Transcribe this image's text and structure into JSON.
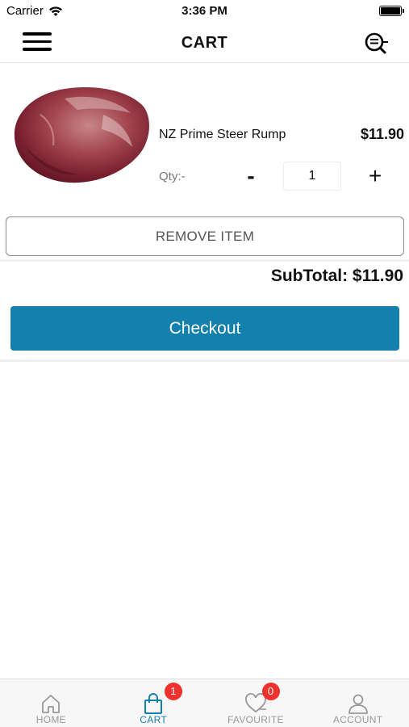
{
  "status_bar": {
    "carrier": "Carrier",
    "time": "3:36 PM"
  },
  "header": {
    "title": "CART",
    "menu_icon": "hamburger-menu-icon",
    "search_icon": "search-list-icon"
  },
  "cart": {
    "items": [
      {
        "name": "NZ Prime Steer Rump",
        "price": "$11.90",
        "qty_label": "Qty:-",
        "qty": "1",
        "minus_label": "-",
        "plus_label": "+",
        "remove_label": "REMOVE ITEM",
        "image": "raw-beef-rump-image"
      }
    ],
    "subtotal": "SubTotal: $11.90",
    "checkout_label": "Checkout"
  },
  "tabs": [
    {
      "label": "HOME",
      "icon": "home-icon",
      "badge": ""
    },
    {
      "label": "CART",
      "icon": "shopping-bag-icon",
      "badge": "1"
    },
    {
      "label": "FAVOURITE",
      "icon": "heart-icon",
      "badge": "0"
    },
    {
      "label": "ACCOUNT",
      "icon": "person-icon",
      "badge": ""
    }
  ],
  "colors": {
    "accent": "#1380ae",
    "badge": "#f0322f",
    "tab_inactive": "#999999"
  }
}
